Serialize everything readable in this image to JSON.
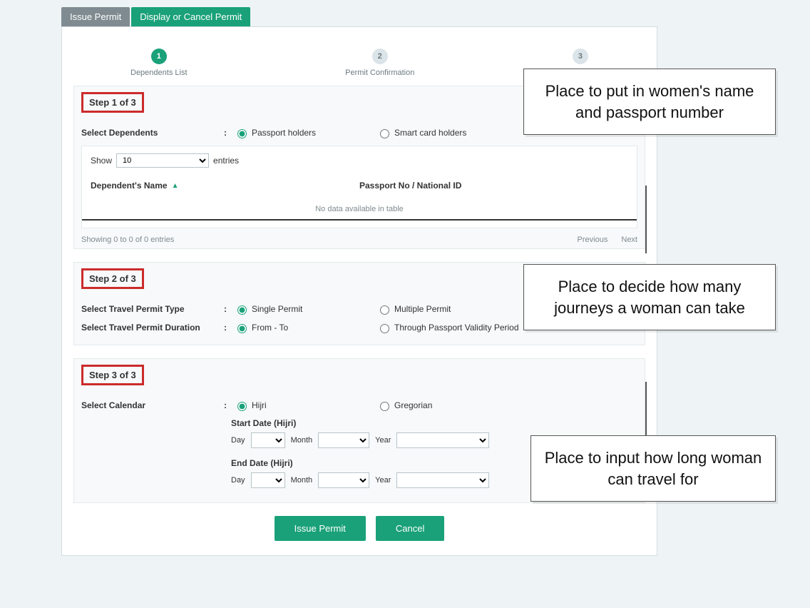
{
  "tabs": {
    "issue": "Issue Permit",
    "display": "Display or Cancel Permit"
  },
  "stepper": {
    "s1_num": "1",
    "s1_label": "Dependents List",
    "s2_num": "2",
    "s2_label": "Permit Confirmation",
    "s3_num": "3",
    "s3_label": ""
  },
  "step1": {
    "title": "Step 1 of 3",
    "select_dependents_label": "Select Dependents",
    "colon": ":",
    "passport_holders": "Passport holders",
    "smart_card_holders": "Smart card holders",
    "show": "Show",
    "show_value": "10",
    "entries": "entries",
    "th_name": "Dependent's Name",
    "th_passport": "Passport No / National ID",
    "no_data": "No data available in table",
    "showing": "Showing 0 to 0 of 0 entries",
    "prev": "Previous",
    "next": "Next"
  },
  "step2": {
    "title": "Step 2 of 3",
    "type_label": "Select Travel Permit Type",
    "single": "Single Permit",
    "multiple": "Multiple Permit",
    "duration_label": "Select Travel Permit Duration",
    "from_to": "From - To",
    "through": "Through Passport Validity Period"
  },
  "step3": {
    "title": "Step 3 of 3",
    "calendar_label": "Select Calendar",
    "hijri": "Hijri",
    "gregorian": "Gregorian",
    "start_title": "Start Date (Hijri)",
    "end_title": "End Date (Hijri)",
    "day": "Day",
    "month": "Month",
    "year": "Year"
  },
  "footer": {
    "issue": "Issue Permit",
    "cancel": "Cancel"
  },
  "callouts": {
    "c1": "Place to put in women's name and passport number",
    "c2": "Place to decide how many journeys a woman can take",
    "c3": "Place to input how long woman can travel for"
  }
}
